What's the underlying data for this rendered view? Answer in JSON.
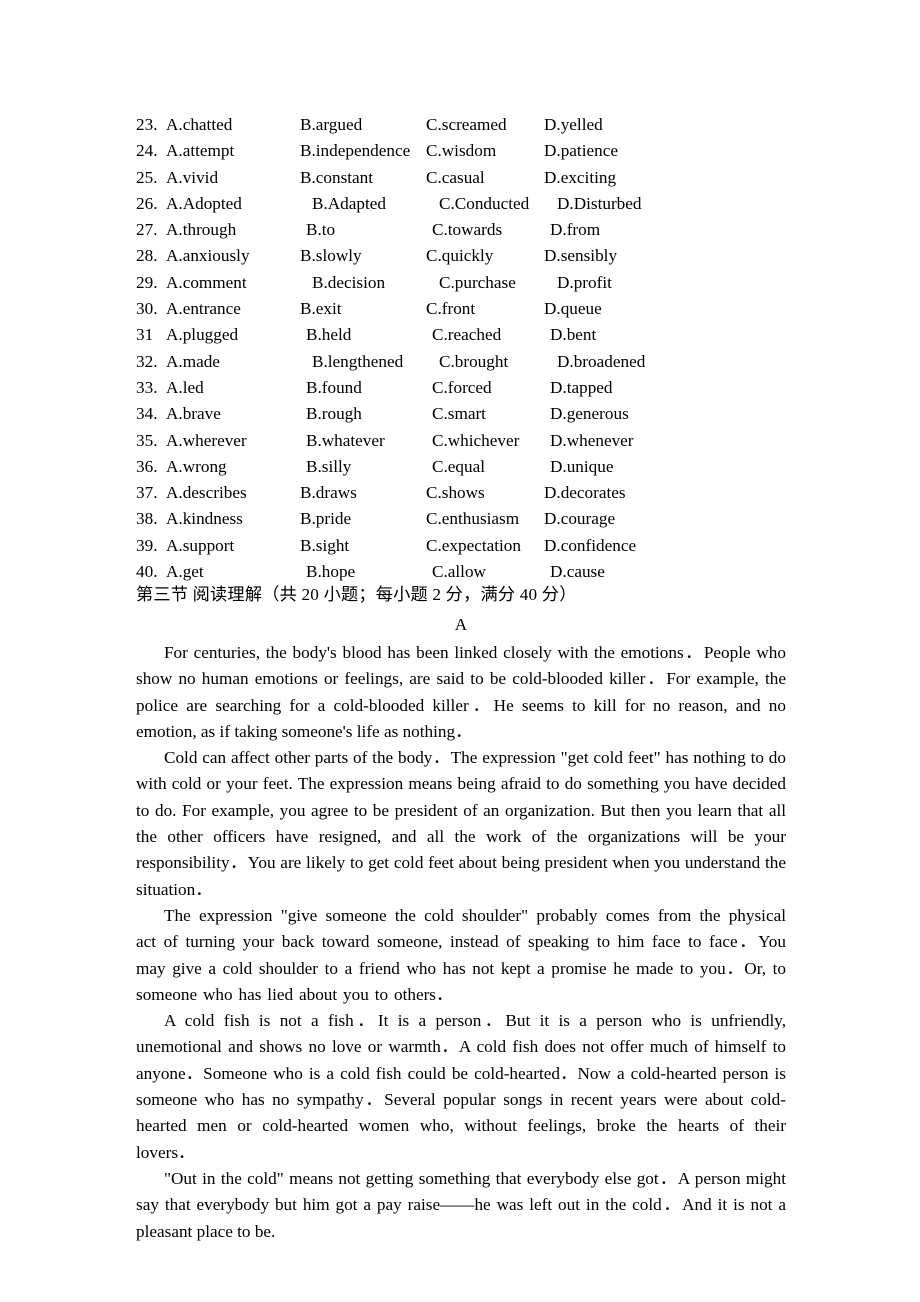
{
  "document": {
    "type": "exam-paper",
    "language_primary": "en",
    "language_secondary": "zh"
  },
  "cloze_options": {
    "items": [
      {
        "number": "23.",
        "a": "A.chatted",
        "b": "B.argued",
        "c": "C.screamed",
        "d": "D.yelled"
      },
      {
        "number": "24.",
        "a": "A.attempt",
        "b": "B.independence",
        "c": "C.wisdom",
        "d": "D.patience"
      },
      {
        "number": "25.",
        "a": "A.vivid",
        "b": "B.constant",
        "c": "C.casual",
        "d": "D.exciting"
      },
      {
        "number": "26.",
        "a": "A.Adopted",
        "b": "B.Adapted",
        "c": "C.Conducted",
        "d": "D.Disturbed"
      },
      {
        "number": "27.",
        "a": "A.through",
        "b": "B.to",
        "c": "C.towards",
        "d": "D.from"
      },
      {
        "number": "28.",
        "a": "A.anxiously",
        "b": "B.slowly",
        "c": "C.quickly",
        "d": "D.sensibly"
      },
      {
        "number": "29.",
        "a": "A.comment",
        "b": "B.decision",
        "c": "C.purchase",
        "d": "D.profit"
      },
      {
        "number": "30.",
        "a": "A.entrance",
        "b": "B.exit",
        "c": "C.front",
        "d": "D.queue"
      },
      {
        "number": "31",
        "a": "A.plugged",
        "b": "B.held",
        "c": "C.reached",
        "d": "D.bent"
      },
      {
        "number": "32.",
        "a": "A.made",
        "b": "B.lengthened",
        "c": "C.brought",
        "d": "D.broadened"
      },
      {
        "number": "33.",
        "a": "A.led",
        "b": "B.found",
        "c": "C.forced",
        "d": "D.tapped"
      },
      {
        "number": "34.",
        "a": "A.brave",
        "b": "B.rough",
        "c": "C.smart",
        "d": "D.generous"
      },
      {
        "number": "35.",
        "a": "A.wherever",
        "b": "B.whatever",
        "c": "C.whichever",
        "d": "D.whenever"
      },
      {
        "number": "36.",
        "a": "A.wrong",
        "b": "B.silly",
        "c": "C.equal",
        "d": "D.unique"
      },
      {
        "number": "37.",
        "a": "A.describes",
        "b": "B.draws",
        "c": "C.shows",
        "d": "D.decorates"
      },
      {
        "number": "38.",
        "a": "A.kindness",
        "b": "B.pride",
        "c": "C.enthusiasm",
        "d": "D.courage"
      },
      {
        "number": "39.",
        "a": "A.support",
        "b": "B.sight",
        "c": "C.expectation",
        "d": "D.confidence"
      },
      {
        "number": "40.",
        "a": "A.get",
        "b": "B.hope",
        "c": "C.allow",
        "d": "D.cause"
      }
    ]
  },
  "section": {
    "heading": "第三节 阅读理解（共 20 小题；每小题 2 分，满分 40 分）",
    "passage_label": "A"
  },
  "passage": {
    "paragraphs": [
      "For centuries, the body's blood has been linked closely with the emotions．People who show no human emotions or feelings, are said to be cold-blooded killer．For example, the police are searching for a cold-blooded killer．He seems to kill for no reason, and no emotion, as if taking someone's life as nothing．",
      "Cold can affect other parts of the body．The expression \"get cold feet\" has nothing to do with cold or your feet. The expression means being afraid to do something you have decided to do. For example, you agree to be president of an organization. But then you learn that all the other officers have resigned, and all the work of the organizations will be your responsibility．You are likely to get cold feet about being president when you understand the situation．",
      "The expression \"give someone the cold shoulder\" probably comes from the physical act of turning your back toward someone, instead of speaking to him face to face．You may give a cold shoulder to a friend who has not kept a promise he made to you．Or, to someone who has lied about you to others．",
      "A cold fish is not a fish．It is a person．But it is a person who is unfriendly, unemotional and shows no love or warmth．A cold fish does not offer much of himself to anyone．Someone who is a cold fish could be cold-hearted．Now a cold-hearted person is someone who has no sympathy．Several popular songs in recent years were about cold-hearted men or cold-hearted women who, without feelings, broke the hearts of their lovers．",
      "\"Out in the cold\" means not getting something that everybody else got．A person might say that everybody but him got a pay raise——he was left out in the cold．And it is not a pleasant place to be."
    ]
  }
}
